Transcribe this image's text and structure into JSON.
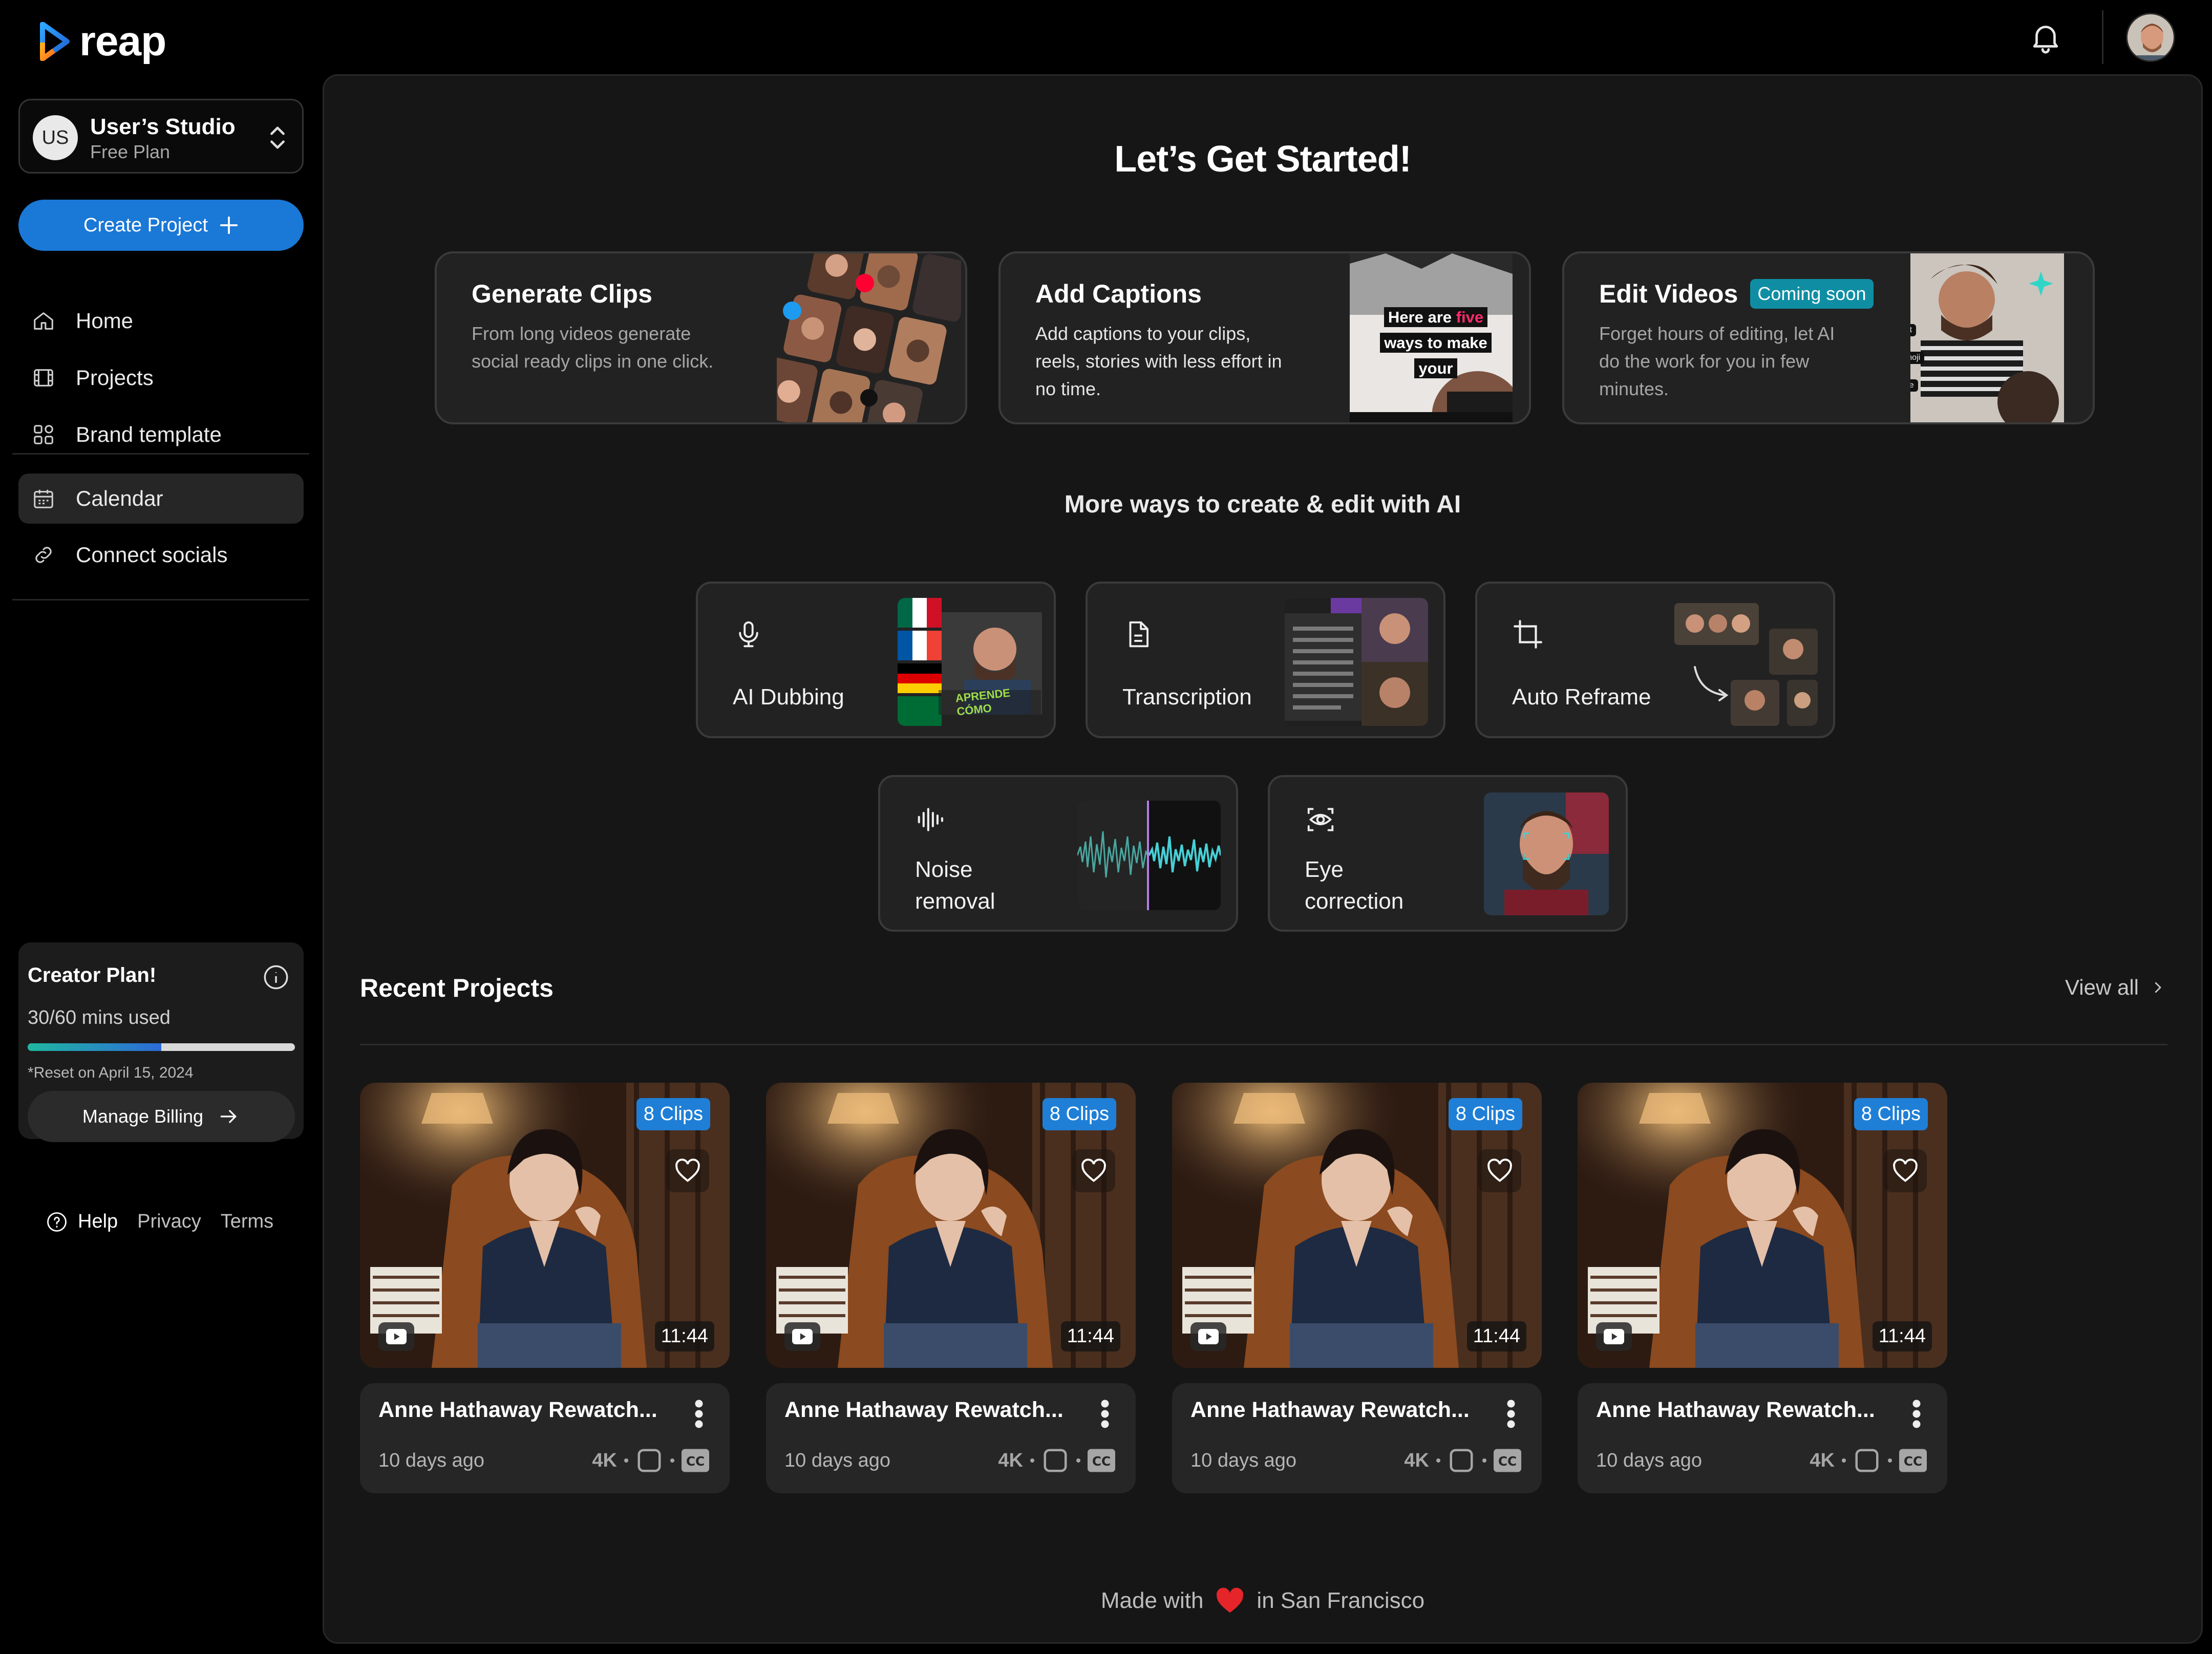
{
  "app": {
    "brand": "reap"
  },
  "studio": {
    "initials": "US",
    "name": "User’s Studio",
    "plan": "Free Plan"
  },
  "sidebar": {
    "create_label": "Create Project",
    "items": [
      {
        "label": "Home",
        "icon": "home-icon"
      },
      {
        "label": "Projects",
        "icon": "film-icon"
      },
      {
        "label": "Brand template",
        "icon": "template-icon"
      },
      {
        "label": "Calendar",
        "icon": "calendar-icon",
        "active": true
      },
      {
        "label": "Connect socials",
        "icon": "link-icon"
      }
    ]
  },
  "plan_card": {
    "title": "Creator Plan!",
    "used_text": "30/60 mins used",
    "used_fraction": 0.5,
    "reset_text": "*Reset on April 15, 2024",
    "billing_label": "Manage Billing"
  },
  "footer_links": {
    "help": "Help",
    "privacy": "Privacy",
    "terms": "Terms"
  },
  "main": {
    "title": "Let’s Get Started!",
    "features": [
      {
        "title": "Generate Clips",
        "desc": "From long videos generate social ready clips in one click."
      },
      {
        "title": "Add Captions",
        "desc": "Add captions to your clips, reels, stories with less effort in no time.",
        "caption_sample": [
          "Here are",
          "five",
          "ways to make",
          "your"
        ]
      },
      {
        "title": "Edit Videos",
        "badge": "Coming soon",
        "desc": "Forget hours of editing, let AI do the work for you in few minutes.",
        "chips": [
          "Split",
          "Add emoji",
          "Animate"
        ]
      }
    ],
    "subtitle": "More ways to create & edit with AI",
    "tools": [
      {
        "label": "AI Dubbing",
        "icon": "microphone-icon",
        "overlay": [
          "APRENDE",
          "CÓMO"
        ]
      },
      {
        "label": "Transcription",
        "icon": "document-icon"
      },
      {
        "label": "Auto Reframe",
        "icon": "crop-icon"
      },
      {
        "label": "Noise\nremoval",
        "icon": "waveform-icon"
      },
      {
        "label": "Eye\ncorrection",
        "icon": "eye-icon"
      }
    ],
    "recent_title": "Recent Projects",
    "view_all": "View all",
    "projects": [
      {
        "name": "Anne Hathaway Rewatch...",
        "clips": "8 Clips",
        "duration": "11:44",
        "date": "10 days ago",
        "quality": "4K"
      },
      {
        "name": "Anne Hathaway Rewatch...",
        "clips": "8 Clips",
        "duration": "11:44",
        "date": "10 days ago",
        "quality": "4K"
      },
      {
        "name": "Anne Hathaway Rewatch...",
        "clips": "8 Clips",
        "duration": "11:44",
        "date": "10 days ago",
        "quality": "4K"
      },
      {
        "name": "Anne Hathaway Rewatch...",
        "clips": "8 Clips",
        "duration": "11:44",
        "date": "10 days ago",
        "quality": "4K"
      }
    ],
    "made_with_prefix": "Made with",
    "made_with_suffix": "in San Francisco"
  },
  "colors": {
    "accent": "#1a78d6",
    "badge": "#1f7fd6",
    "coming_soon": "#0f8ea3",
    "heart": "#e5252a",
    "caption_highlight": "#ff2a6d"
  }
}
